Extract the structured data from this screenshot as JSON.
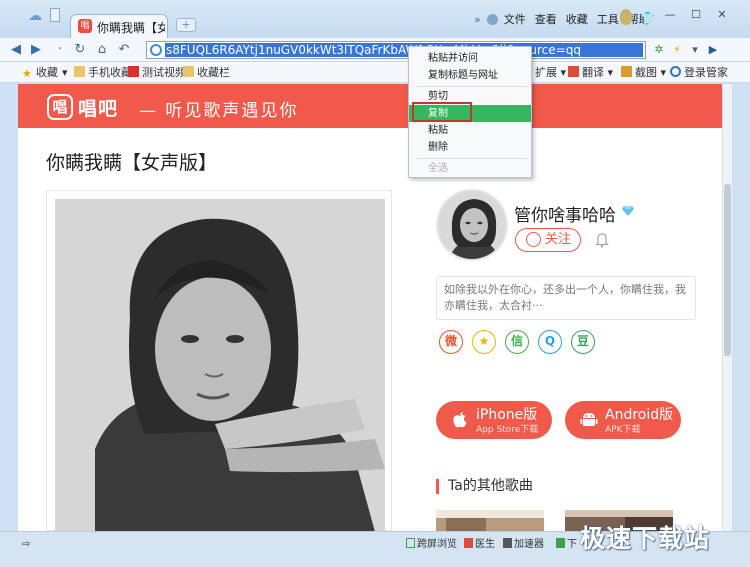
{
  "browser": {
    "tab_title": "你瞒我瞒【女声",
    "new_tab": "+",
    "menu": [
      "文件",
      "查看",
      "收藏",
      "工具",
      "帮助"
    ],
    "menu_arrow": "»",
    "window_buttons": [
      "—",
      "☐",
      "✕"
    ],
    "address": "s8FUQL6R6AYtj1nuGV0kkWt3lTQaFrKbAW1GX...MhVro2ii&source=qq",
    "bookmarks": [
      {
        "label": "收藏"
      },
      {
        "label": "手机收藏"
      },
      {
        "label": "测试视频"
      },
      {
        "label": "收藏栏"
      },
      {
        "label": "扩展"
      },
      {
        "label": "翻译"
      },
      {
        "label": "截图"
      },
      {
        "label": "登录管家"
      }
    ]
  },
  "site": {
    "logo_icon": "唱",
    "logo_text": "唱吧",
    "slogan": "— 听见歌声遇见你"
  },
  "song": {
    "title": "你瞒我瞒【女声版】"
  },
  "artist": {
    "name": "管你啥事哈哈",
    "follow_label": "关注",
    "bio": "如除我以外在你心，还多出一个人，你瞒住我，我亦瞒住我，太合衬···"
  },
  "share": [
    {
      "name": "weibo",
      "glyph": "微",
      "color": "#e8542b"
    },
    {
      "name": "qzone",
      "glyph": "★",
      "color": "#f0b400"
    },
    {
      "name": "wechat",
      "glyph": "信",
      "color": "#3db04b"
    },
    {
      "name": "qq",
      "glyph": "Q",
      "color": "#2aa0e6"
    },
    {
      "name": "douban",
      "glyph": "豆",
      "color": "#3aa35b"
    }
  ],
  "downloads": {
    "iphone": {
      "label": "iPhone版",
      "sub": "App Store下载",
      "icon": ""
    },
    "android": {
      "label": "Android版",
      "sub": "APK下载",
      "icon": "🤖"
    }
  },
  "other_songs": {
    "title": "Ta的其他歌曲"
  },
  "context_menu": {
    "items": [
      {
        "label": "粘贴并访问"
      },
      {
        "label": "复制标题与网址"
      },
      {
        "label": "剪切"
      },
      {
        "label": "复制"
      },
      {
        "label": "粘贴"
      },
      {
        "label": "删除"
      },
      {
        "label": "全选"
      }
    ]
  },
  "statusbar": {
    "items": [
      {
        "label": "跨屏浏览"
      },
      {
        "label": "医生"
      },
      {
        "label": "加速器"
      },
      {
        "label": "下"
      }
    ],
    "watermark": "极速下载站"
  }
}
